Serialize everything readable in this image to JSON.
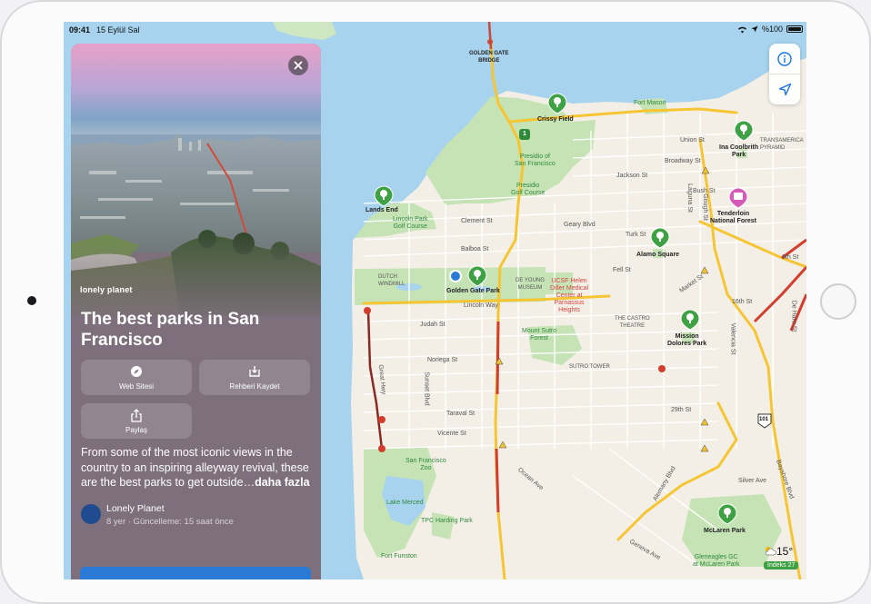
{
  "status_bar": {
    "time": "09:41",
    "date": "15 Eylül Sal",
    "battery": "%100"
  },
  "guide": {
    "brand": "lonely planet",
    "title": "The best parks in San Francisco",
    "actions": {
      "website": "Web Sitesi",
      "save": "Rehberi Kaydet",
      "share": "Paylaş"
    },
    "description": "From some of the most iconic views in the country to an inspiring alleyway revival, these are the best parks to get outside…",
    "more": "daha fazla",
    "author": "Lonely Planet",
    "meta": "8 yer · Güncelleme: 15 saat önce"
  },
  "weather": {
    "temp": "15°",
    "aqi": "İndeks 27"
  },
  "map": {
    "labels": {
      "ggb": "GOLDEN GATE\nBRIDGE",
      "crissy": "Crissy Field",
      "fort_mason": "Fort Mason",
      "presidio": "Presidio of\nSan Francisco",
      "presidio_golf": "Presidio\nGolf Course",
      "coolbrith": "Ina Coolbrith\nPark",
      "transamerica": "TRANSAMERICA\nPYRAMID",
      "tenderloin": "Tenderloin\nNational Forest",
      "lands_end": "Lands End",
      "lincoln_golf": "Lincoln Park\nGolf Course",
      "alamo": "Alamo Square",
      "dutch_windmill": "DUTCH\nWINDMILL",
      "gg_park": "Golden Gate Park",
      "de_young": "DE YOUNG\nMUSEUM",
      "ucsf": "UCSF Helen\nDiller Medical\nCenter at\nParnassus\nHeights",
      "castro": "THE CASTRO\nTHEATRE",
      "mission_dolores": "Mission\nDolores Park",
      "sutro_forest": "Mount Sutro\nForest",
      "sutro_tower": "SUTRO TOWER",
      "zoo": "San Francisco\nZoo",
      "lake_merced": "Lake Merced",
      "tpc": "TPC Harding Park",
      "fort_funston": "Fort Funston",
      "mclaren": "McLaren Park",
      "gleneagles": "Gleneagles GC\nat McLaren Park",
      "clement": "Clement St",
      "geary": "Geary Blvd",
      "balboa": "Balboa St",
      "turk": "Turk St",
      "fell": "Fell St",
      "lincoln_way": "Lincoln Way",
      "judah": "Judah St",
      "noriega": "Noriega St",
      "taraval": "Taraval St",
      "vicente": "Vicente St",
      "great_hwy": "Great Hwy",
      "sunset": "Sunset Blvd",
      "union": "Union St",
      "broadway": "Broadway St",
      "jackson": "Jackson St",
      "bush": "Bush St",
      "laguna": "Laguna St",
      "gough": "Gough St",
      "market": "Market St",
      "sixteenth": "16th St",
      "twentyninth": "29th St",
      "valencia": "Valencia St",
      "ocean": "Ocean Ave",
      "alemany": "Alemany Blvd",
      "silver": "Silver Ave",
      "geneva": "Geneva Ave",
      "bayshore": "Bayshore Blvd",
      "de_haro": "De Haro St",
      "eighth": "8th St",
      "hwy101": "101",
      "hwy1": "1"
    }
  },
  "colors": {
    "water": "#a7d3ee",
    "park": "#c6e3b6",
    "land": "#f3efe7",
    "highway": "#f6c533",
    "accent": "#2a7ad6"
  }
}
